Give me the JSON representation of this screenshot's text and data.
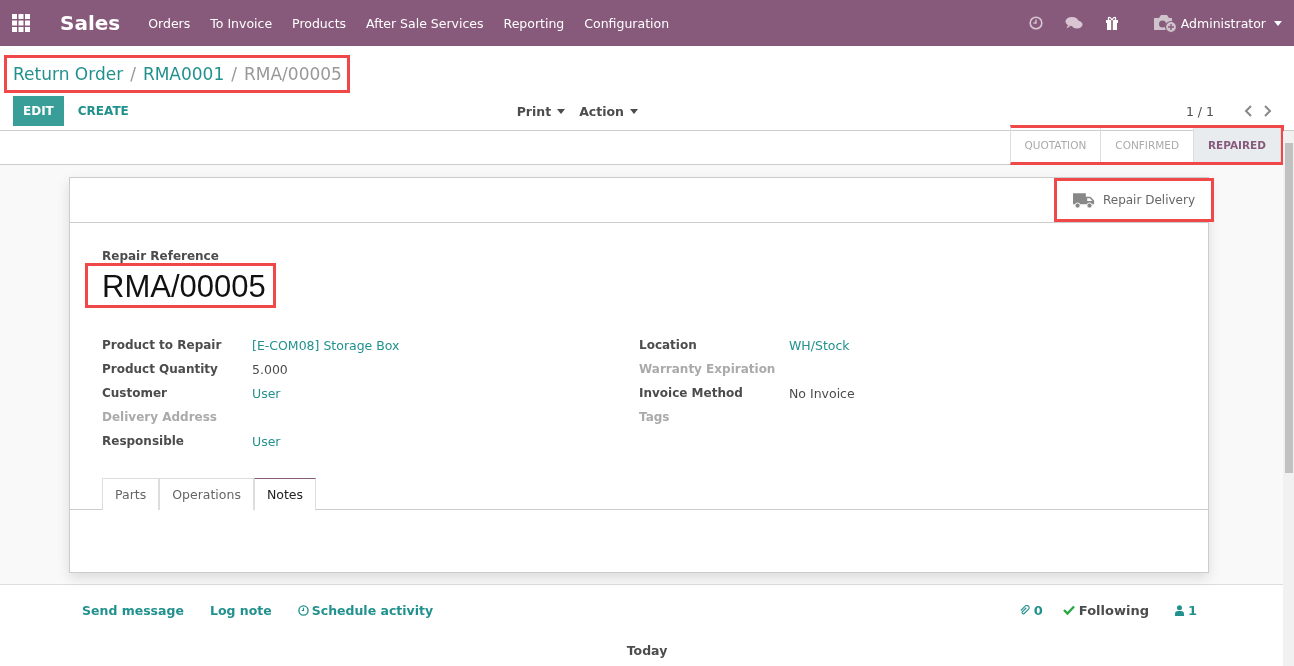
{
  "navbar": {
    "app_name": "Sales",
    "menu": [
      "Orders",
      "To Invoice",
      "Products",
      "After Sale Services",
      "Reporting",
      "Configuration"
    ],
    "user": "Administrator"
  },
  "breadcrumbs": {
    "highlighted": true,
    "separators": [
      "/",
      "/"
    ],
    "items": [
      {
        "label": "Return Order",
        "link": true
      },
      {
        "label": "RMA0001",
        "link": true
      },
      {
        "label": "RMA/00005",
        "link": false
      }
    ]
  },
  "buttons": {
    "edit": "EDIT",
    "create": "CREATE",
    "print": "Print",
    "action": "Action"
  },
  "pager": "1 / 1",
  "statusbar": {
    "highlighted": true,
    "stages": [
      {
        "label": "QUOTATION",
        "selected": false
      },
      {
        "label": "CONFIRMED",
        "selected": false
      },
      {
        "label": "REPAIRED",
        "selected": true
      }
    ]
  },
  "smart_button": {
    "label": "Repair Delivery",
    "highlighted": true
  },
  "title": {
    "label": "Repair Reference",
    "value": "RMA/00005",
    "highlighted": true
  },
  "left_fields": [
    {
      "label": "Product to Repair",
      "value": "[E-COM08] Storage Box",
      "link": true,
      "empty": false
    },
    {
      "label": "Product Quantity",
      "value": "5.000",
      "link": false,
      "empty": false
    },
    {
      "label": "Customer",
      "value": "User",
      "link": true,
      "empty": false
    },
    {
      "label": "Delivery Address",
      "empty": true
    },
    {
      "label": "Responsible",
      "value": "User",
      "link": true,
      "empty": false
    }
  ],
  "right_fields": [
    {
      "label": "Location",
      "value": "WH/Stock",
      "link": true,
      "empty": false
    },
    {
      "label": "Warranty Expiration",
      "empty": true
    },
    {
      "label": "Invoice Method",
      "value": "No Invoice",
      "link": false,
      "empty": false
    },
    {
      "label": "Tags",
      "empty": true
    }
  ],
  "tabs": [
    {
      "label": "Parts",
      "selected": false
    },
    {
      "label": "Operations",
      "selected": false
    },
    {
      "label": "Notes",
      "selected": true
    }
  ],
  "chatter": {
    "send_message": "Send message",
    "log_note": "Log note",
    "schedule_activity": "Schedule activity",
    "attachments": "0",
    "following": "Following",
    "followers": "1",
    "day_separator": "Today"
  }
}
